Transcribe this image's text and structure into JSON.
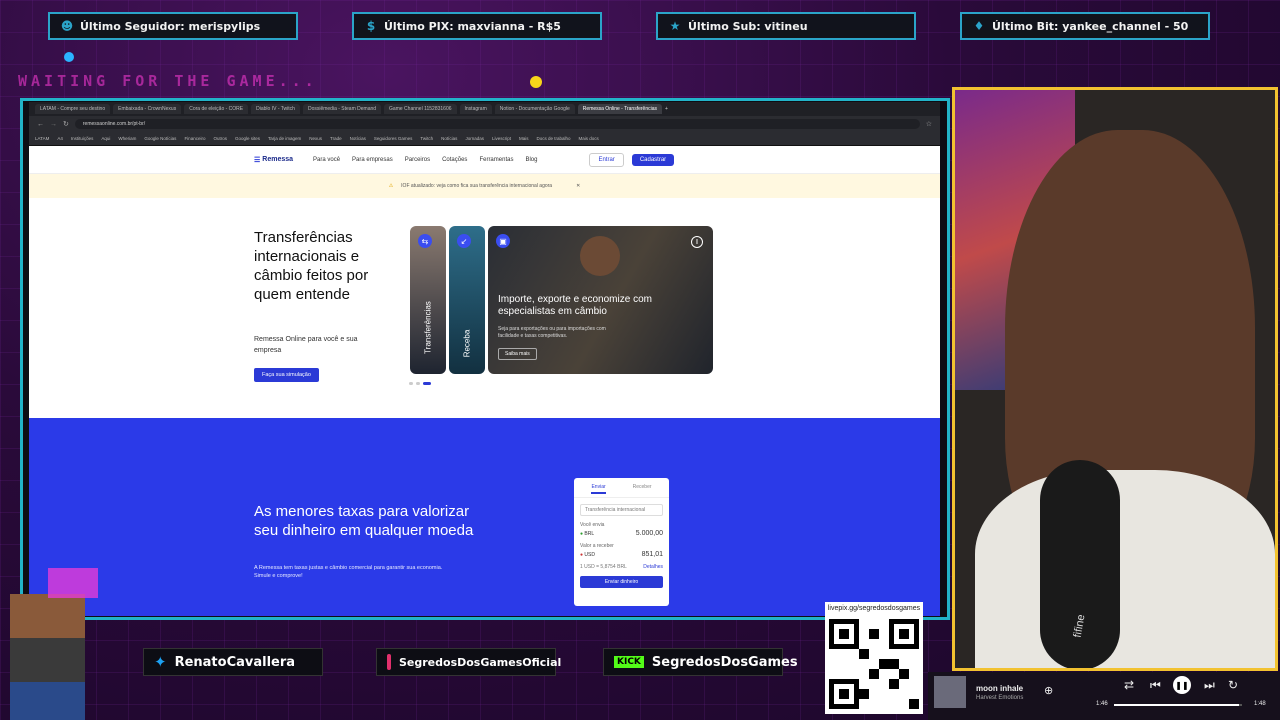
{
  "top_bar": {
    "follower": "Último Seguidor: merispylips",
    "pix": "Último PIX: maxvianna - R$5",
    "sub": "Último Sub: vitineu",
    "bit": "Último Bit: yankee_channel - 50"
  },
  "waiting_text": "WAITING FOR THE GAME...",
  "browser": {
    "tabs": [
      "LATAM - Compre seu destino",
      "Embaixada - CrownNexus",
      "Cora de eleição - CORE",
      "Diablo IV - Twitch",
      "Dossiêmedia - Steam Demand",
      "Game Channel 1152831606",
      "Instagram",
      "Notion - Documentação Google",
      "Remessa Online - Transferências"
    ],
    "active_tab": "Remessa Online - Transferências",
    "url": "remessaonline.com.br/pt-br/",
    "bookmarks": [
      "LATAM",
      "A4",
      "Instituições",
      "Aqui",
      "Wheriam",
      "Google Notícias",
      "Financeiro",
      "Outros",
      "Google sites",
      "Tarja de imagem",
      "Nexus",
      "Trade",
      "Notícias",
      "Seguidores Games",
      "Twitch",
      "Notícias",
      "Jornadas",
      "Livescript",
      "Mais",
      "Docs de trabalho",
      "Mais docs"
    ]
  },
  "site": {
    "logo": "Remessa",
    "logo_sub": "online",
    "nav": [
      "Para você",
      "Para empresas",
      "Parceiros",
      "Cotações",
      "Ferramentas",
      "Blog"
    ],
    "entrar": "Entrar",
    "cadastrar": "Cadastrar",
    "banner": "IOF atualizado: veja como fica sua transferência internacional agora",
    "hero_title": "Transferências internacionais e câmbio feitos por quem entende",
    "hero_sub": "Remessa Online para você e sua empresa",
    "hero_cta": "Faça sua simulação",
    "card1": "Transferências",
    "card2": "Receba",
    "card3_title": "Importe, exporte e economize com especialistas em câmbio",
    "card3_text": "Seja para exportações ou para importações com facilidade e taxas competitivas.",
    "card3_cta": "Saiba mais",
    "blue_title": "As menores taxas para valorizar seu dinheiro em qualquer moeda",
    "blue_text": "A Remessa tem taxas justas e câmbio comercial para garantir sua economia. Simule e comprove!",
    "calc": {
      "tab_send": "Enviar",
      "tab_receive": "Receber",
      "mode": "Transferência internacional",
      "you_send": "Você envia",
      "send_cur": "BRL",
      "send_val": "5.000,00",
      "you_receive": "Valor a receber",
      "recv_cur": "USD",
      "recv_val": "851,01",
      "rate": "1 USD = 5,8754 BRL",
      "details": "Detalhes",
      "cta": "Enviar dinheiro"
    }
  },
  "socials": {
    "twitter": "RenatoCavallera",
    "instagram": "SegredosDosGamesOficial",
    "kick": "SegredosDosGames",
    "kick_icon": "KICK"
  },
  "qr_label": "livepix.gg/segredosdosgames",
  "webcam": {
    "mic_brand": "fifine"
  },
  "player": {
    "title": "moon inhale",
    "artist": "Harvest Emotions",
    "time_elapsed": "1:46",
    "time_total": "1:48",
    "progress": 0.98
  }
}
